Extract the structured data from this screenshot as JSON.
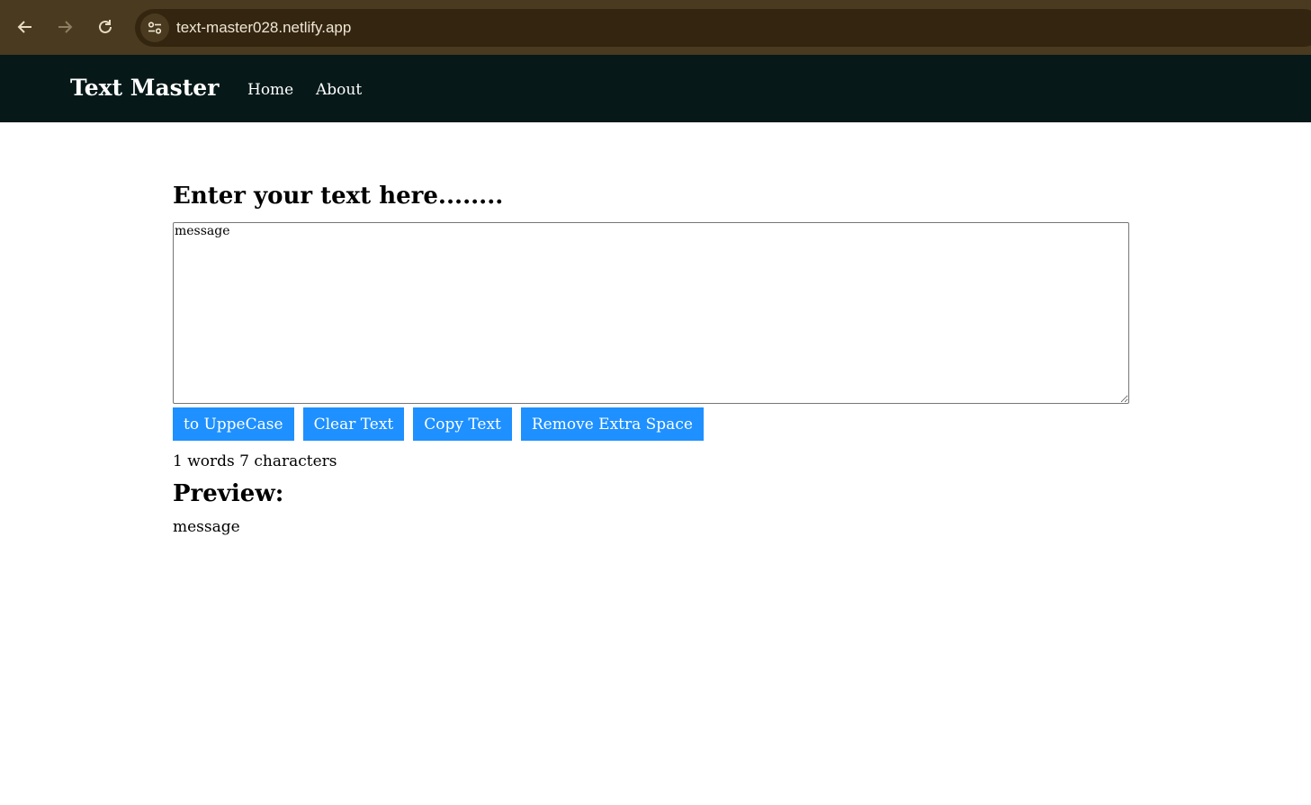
{
  "browser": {
    "url": "text-master028.netlify.app",
    "back_icon": "arrow-left-icon",
    "forward_icon": "arrow-right-icon",
    "reload_icon": "reload-icon",
    "site_info_icon": "tune-icon"
  },
  "navbar": {
    "brand": "Text Master",
    "links": [
      "Home",
      "About"
    ],
    "background": "#061818"
  },
  "main": {
    "heading": "Enter your text here........",
    "textarea_value": "message",
    "buttons": [
      "to UppeCase",
      "Clear Text",
      "Copy Text",
      "Remove Extra Space"
    ],
    "button_color": "#1e90ff",
    "summary": "1 words 7 characters",
    "preview_heading": "Preview:",
    "preview_text": "message"
  }
}
